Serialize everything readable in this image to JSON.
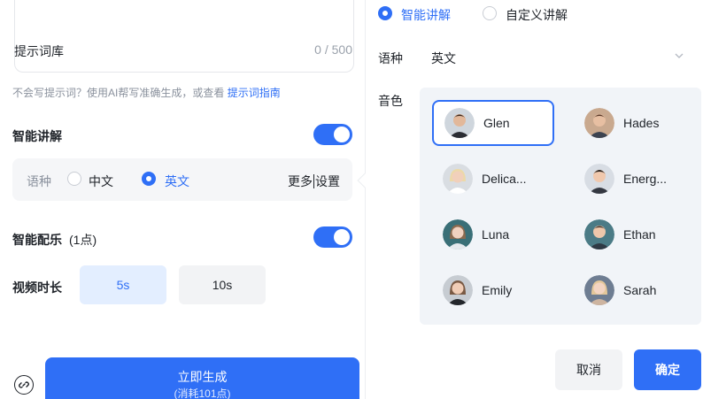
{
  "left": {
    "prompt_library": "提示词库",
    "char_count": "0 / 500",
    "hint_text": "不会写提示词？使用AI帮写准确生成，或查看 ",
    "hint_link": "提示词指南",
    "narration": {
      "title": "智能讲解",
      "enabled": true,
      "lang_label": "语种",
      "options": [
        "中文",
        "英文"
      ],
      "selected": "英文",
      "more_settings": [
        "更多",
        "设置"
      ]
    },
    "music": {
      "title": "智能配乐",
      "cost": "(1点)",
      "enabled": true
    },
    "duration": {
      "title": "视频时长",
      "options": [
        "5s",
        "10s"
      ],
      "selected": "5s"
    },
    "generate": {
      "label": "立即生成",
      "sub": "(消耗101点)"
    }
  },
  "right": {
    "modes": [
      "智能讲解",
      "自定义讲解"
    ],
    "selected_mode": "智能讲解",
    "lang_label": "语种",
    "lang_value": "英文",
    "voice_label": "音色",
    "voices": [
      "Glen",
      "Hades",
      "Delica...",
      "Energ...",
      "Luna",
      "Ethan",
      "Emily",
      "Sarah"
    ],
    "selected_voice": "Glen",
    "cancel": "取消",
    "confirm": "确定"
  },
  "colors": {
    "accent": "#2f6ff6",
    "panel": "#f1f4f8"
  }
}
